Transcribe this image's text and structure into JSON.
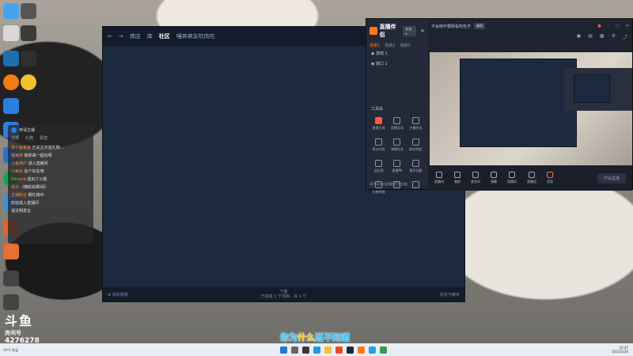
{
  "community_window": {
    "nav_back": "←",
    "nav_forward": "→",
    "tab_shop": "商店",
    "tab_library": "库",
    "tab_community": "社区",
    "tab_user": "嘎奔麻友吹肉吃",
    "bottom_left": "添加游戏",
    "bottom_center_line1": "下载",
    "bottom_center_line2": "已完成 1 个项目，共 1 个",
    "bottom_right": "好友与聊天"
  },
  "stream_tool": {
    "app_name": "直播伴侣",
    "version_badge": "标准 ▾",
    "tabs": [
      "场景1",
      "场景2",
      "场景3"
    ],
    "scenes": [
      "游戏 1",
      "窗口 1"
    ],
    "tools_header": "工具库",
    "tools": [
      "直播工具",
      "直播互动",
      "主播任务",
      "帮派任务",
      "弹幕任务",
      "粉丝特权",
      "送礼榜",
      "直播PK",
      "更多功能",
      "礼物特效",
      "",
      ""
    ],
    "tip": "请手动开启直播间打赏功能",
    "stream_title": "不会吧不要转看吃吃不",
    "title_chip": "编辑",
    "toolbar": [
      "直播间",
      "美颜",
      "麦克风",
      "弹幕",
      "直播间",
      "直播设",
      "音效",
      ""
    ],
    "live_button": "开始直播"
  },
  "chat": {
    "room_id": "申请主播",
    "tabs": [
      "全部",
      "礼物",
      "贵宾"
    ],
    "lines": [
      {
        "user": "张小鱼鱼鱼",
        "msg": "已关注并送礼物..."
      },
      {
        "user": "猪猪侠",
        "msg": "和你来一起玩呀"
      },
      {
        "user": "斗鱼用户",
        "msg": "进入直播间"
      },
      {
        "user": "小美女",
        "msg": "加个好友吧"
      },
      {
        "user": "Vincent",
        "msg": "送出了火箭"
      },
      {
        "user": "观众",
        "msg": "《精彩的瞬间》"
      },
      {
        "user": "主播粉丝",
        "msg": "刷礼物中"
      },
      {
        "user": "",
        "msg": "欢迎进入直播间"
      },
      {
        "user": "",
        "msg": "请文明发言"
      }
    ]
  },
  "brand": {
    "logo": "斗鱼",
    "room_label": "房间号",
    "room_number": "4276278"
  },
  "subtitle": {
    "before": "你为",
    "highlight": "什么",
    "after": "还不知道"
  },
  "taskbar": {
    "weather": "19°C 多云",
    "time": "16:47",
    "date": "2022/2/26"
  },
  "colors": {
    "accent": "#ff7a1a",
    "subtitle": "#23c0ff",
    "highlight": "#ffd200"
  }
}
